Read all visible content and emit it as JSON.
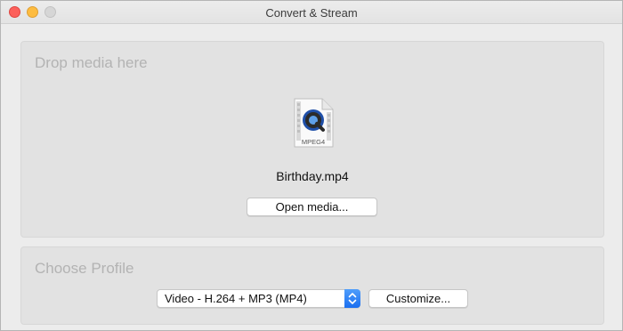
{
  "window": {
    "title": "Convert & Stream"
  },
  "drop": {
    "heading": "Drop media here",
    "file_icon_label": "MPEG4",
    "file_name": "Birthday.mp4",
    "open_button": "Open media..."
  },
  "profile": {
    "heading": "Choose Profile",
    "selected": "Video - H.264 + MP3 (MP4)",
    "customize_button": "Customize..."
  },
  "icons": {
    "close": "close-icon",
    "minimize": "minimize-icon",
    "zoom": "zoom-icon",
    "file": "quicktime-file-icon",
    "select_arrows": "chevron-updown-icon"
  },
  "colors": {
    "accent": "#1b6ff0",
    "close": "#fc605b",
    "minimize": "#fdbc40",
    "zoom_disabled": "#d6d6d6"
  }
}
